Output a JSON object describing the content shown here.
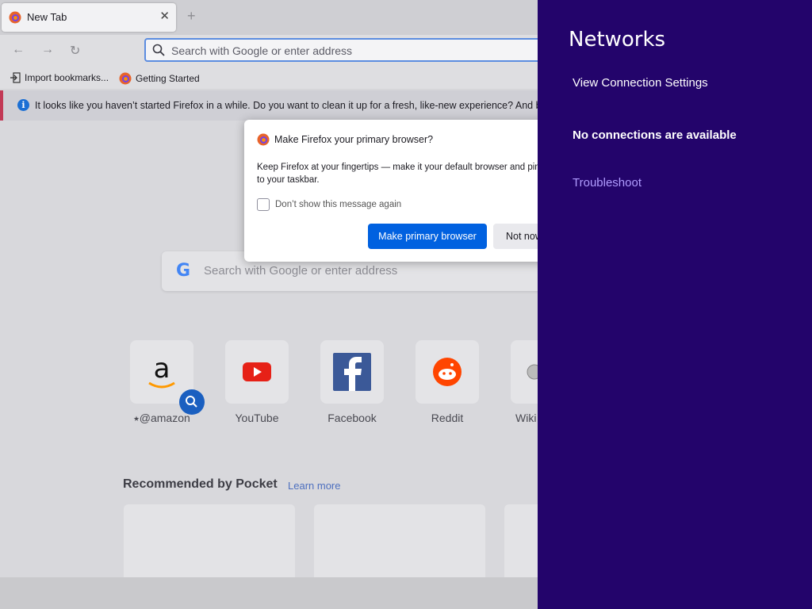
{
  "browser": {
    "tab": {
      "title": "New Tab",
      "close": "✕"
    },
    "new_tab": "+",
    "nav": {
      "back": "←",
      "forward": "→",
      "reload": "↻"
    },
    "urlbar": {
      "placeholder": "Search with Google or enter address"
    },
    "bookmarks": [
      {
        "label": "Import bookmarks..."
      },
      {
        "label": "Getting Started"
      }
    ],
    "notice": "It looks like you haven’t started Firefox in a while. Do you want to clean it up for a fresh, like-new experience? And by the"
  },
  "newtab": {
    "search_placeholder": "Search with Google or enter address",
    "search_logo": "G",
    "top_sites": [
      {
        "label": "@amazon"
      },
      {
        "label": "YouTube"
      },
      {
        "label": "Facebook"
      },
      {
        "label": "Reddit"
      },
      {
        "label": "Wiki"
      }
    ],
    "pocket": {
      "title": "Recommended by Pocket",
      "link": "Learn more"
    }
  },
  "dialog": {
    "title": "Make Firefox your primary browser?",
    "body": "Keep Firefox at your fingertips — make it your default browser and pin it to your taskbar.",
    "checkbox_label": "Don’t show this message again",
    "primary_button": "Make primary browser",
    "secondary_button": "Not now"
  },
  "networks": {
    "title": "Networks",
    "view_settings": "View Connection Settings",
    "status": "No connections are available",
    "troubleshoot": "Troubleshoot"
  },
  "taskbar": {
    "items": [
      {
        "icon": "file-explorer-icon"
      },
      {
        "icon": "chrome-icon"
      },
      {
        "icon": "firefox-icon",
        "active": true
      }
    ]
  },
  "colors": {
    "charm_bg": "#23046b",
    "accent": "#0061e0",
    "troubleshoot": "#b09cff"
  }
}
